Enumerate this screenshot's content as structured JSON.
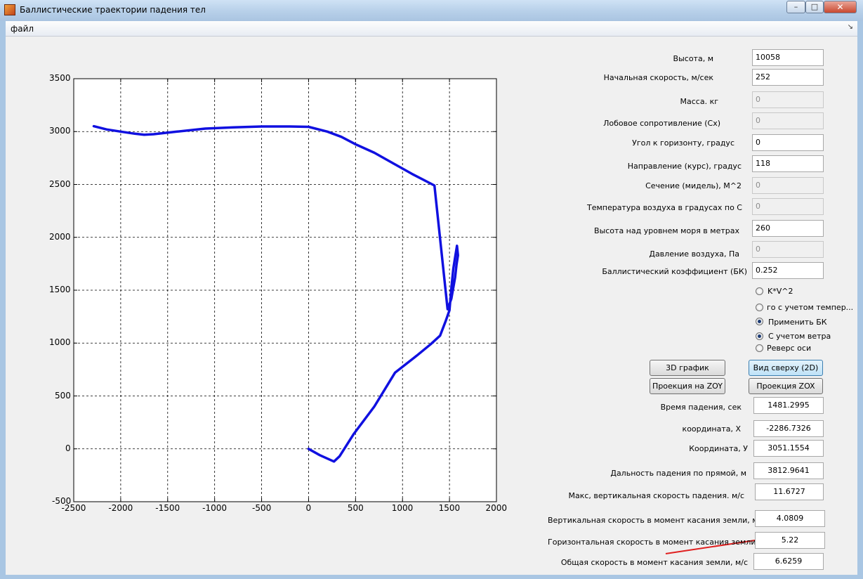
{
  "window": {
    "title": "Баллистические траектории падения тел",
    "min_glyph": "–",
    "max_glyph": "□",
    "close_glyph": "✕",
    "menu_file": "файл",
    "menu_arrow": "↘"
  },
  "inputs": [
    {
      "label": "Высота, м",
      "value": "10058",
      "enabled": true
    },
    {
      "label": "Начальная скорость, м/сек",
      "value": "252",
      "enabled": true
    },
    {
      "label": "Масса. кг",
      "value": "0",
      "enabled": false
    },
    {
      "label": "Лобовое сопротивление (Сх)",
      "value": "0",
      "enabled": false
    },
    {
      "label": "Угол к горизонту, градус",
      "value": "0",
      "enabled": true
    },
    {
      "label": "Направление  (курс), градус",
      "value": "118",
      "enabled": true
    },
    {
      "label": "Сечение (мидель), М^2",
      "value": "0",
      "enabled": false
    },
    {
      "label": "Температура воздуха в градусах по С",
      "value": "0",
      "enabled": false
    },
    {
      "label": "Высота над уровнем моря в метрах",
      "value": "260",
      "enabled": true
    },
    {
      "label": "Давление воздуха, Па",
      "value": "0",
      "enabled": false
    },
    {
      "label": "Баллистический коэффициент (БК)",
      "value": "0.252",
      "enabled": true
    }
  ],
  "options": [
    {
      "label": "K*V^2",
      "checked": false
    },
    {
      "label": "го с учетом темпер...",
      "checked": false
    },
    {
      "label": "Применить БК",
      "checked": true
    },
    {
      "label": "С учетом ветра",
      "checked": true
    },
    {
      "label": "Реверс оси",
      "checked": false
    }
  ],
  "buttons": {
    "plot3d": "3D график",
    "top_view": "Вид сверху (2D)",
    "proj_zoy": "Проекция на ZOY",
    "proj_zox": "Проекция ZOX"
  },
  "results": [
    {
      "label": "Время падения, сек",
      "value": "1481.2995"
    },
    {
      "label": "координата, Х",
      "value": "-2286.7326"
    },
    {
      "label": "Координата, У",
      "value": "3051.1554"
    },
    {
      "label": "Дальность падения по прямой, м",
      "value": "3812.9641"
    },
    {
      "label": "Макс,  вертикальная скорость падения. м/с",
      "value": "11.6727"
    },
    {
      "label": "Вертикальная  скорость в момент касания земли, м/с",
      "value": "4.0809"
    },
    {
      "label": "Горизонтальная скорость в момент касания земли, м/с",
      "value": "5.22"
    },
    {
      "label": "Общая скорость в момент касания земли, м/с",
      "value": "6.6259"
    }
  ],
  "annotation_color": "#e02020",
  "chart_data": {
    "type": "line",
    "xlim": [
      -2500,
      2000
    ],
    "ylim": [
      -500,
      3500
    ],
    "xticks": [
      -2500,
      -2000,
      -1500,
      -1000,
      -500,
      0,
      500,
      1000,
      1500,
      2000
    ],
    "yticks": [
      -500,
      0,
      500,
      1000,
      1500,
      2000,
      2500,
      3000,
      3500
    ],
    "grid": true,
    "color": "#1010e0",
    "series": [
      {
        "x": [
          0,
          120,
          270,
          330,
          480,
          700,
          920,
          1150,
          1300,
          1400,
          1460,
          1500,
          1520,
          1540,
          1560,
          1580,
          1590,
          1575,
          1560,
          1520,
          1480,
          1340,
          1100,
          900,
          700,
          500,
          350,
          200,
          0,
          -200,
          -500,
          -800,
          -1100,
          -1400,
          -1650,
          -1750,
          -1850,
          -2000,
          -2150,
          -2286.73
        ],
        "y": [
          0,
          -60,
          -120,
          -70,
          140,
          400,
          720,
          880,
          990,
          1070,
          1210,
          1310,
          1520,
          1700,
          1810,
          1920,
          1830,
          1740,
          1620,
          1420,
          1320,
          2490,
          2600,
          2700,
          2800,
          2880,
          2950,
          3000,
          3045,
          3048,
          3048,
          3040,
          3028,
          3000,
          2975,
          2970,
          2980,
          3000,
          3020,
          3051.16
        ]
      }
    ]
  }
}
